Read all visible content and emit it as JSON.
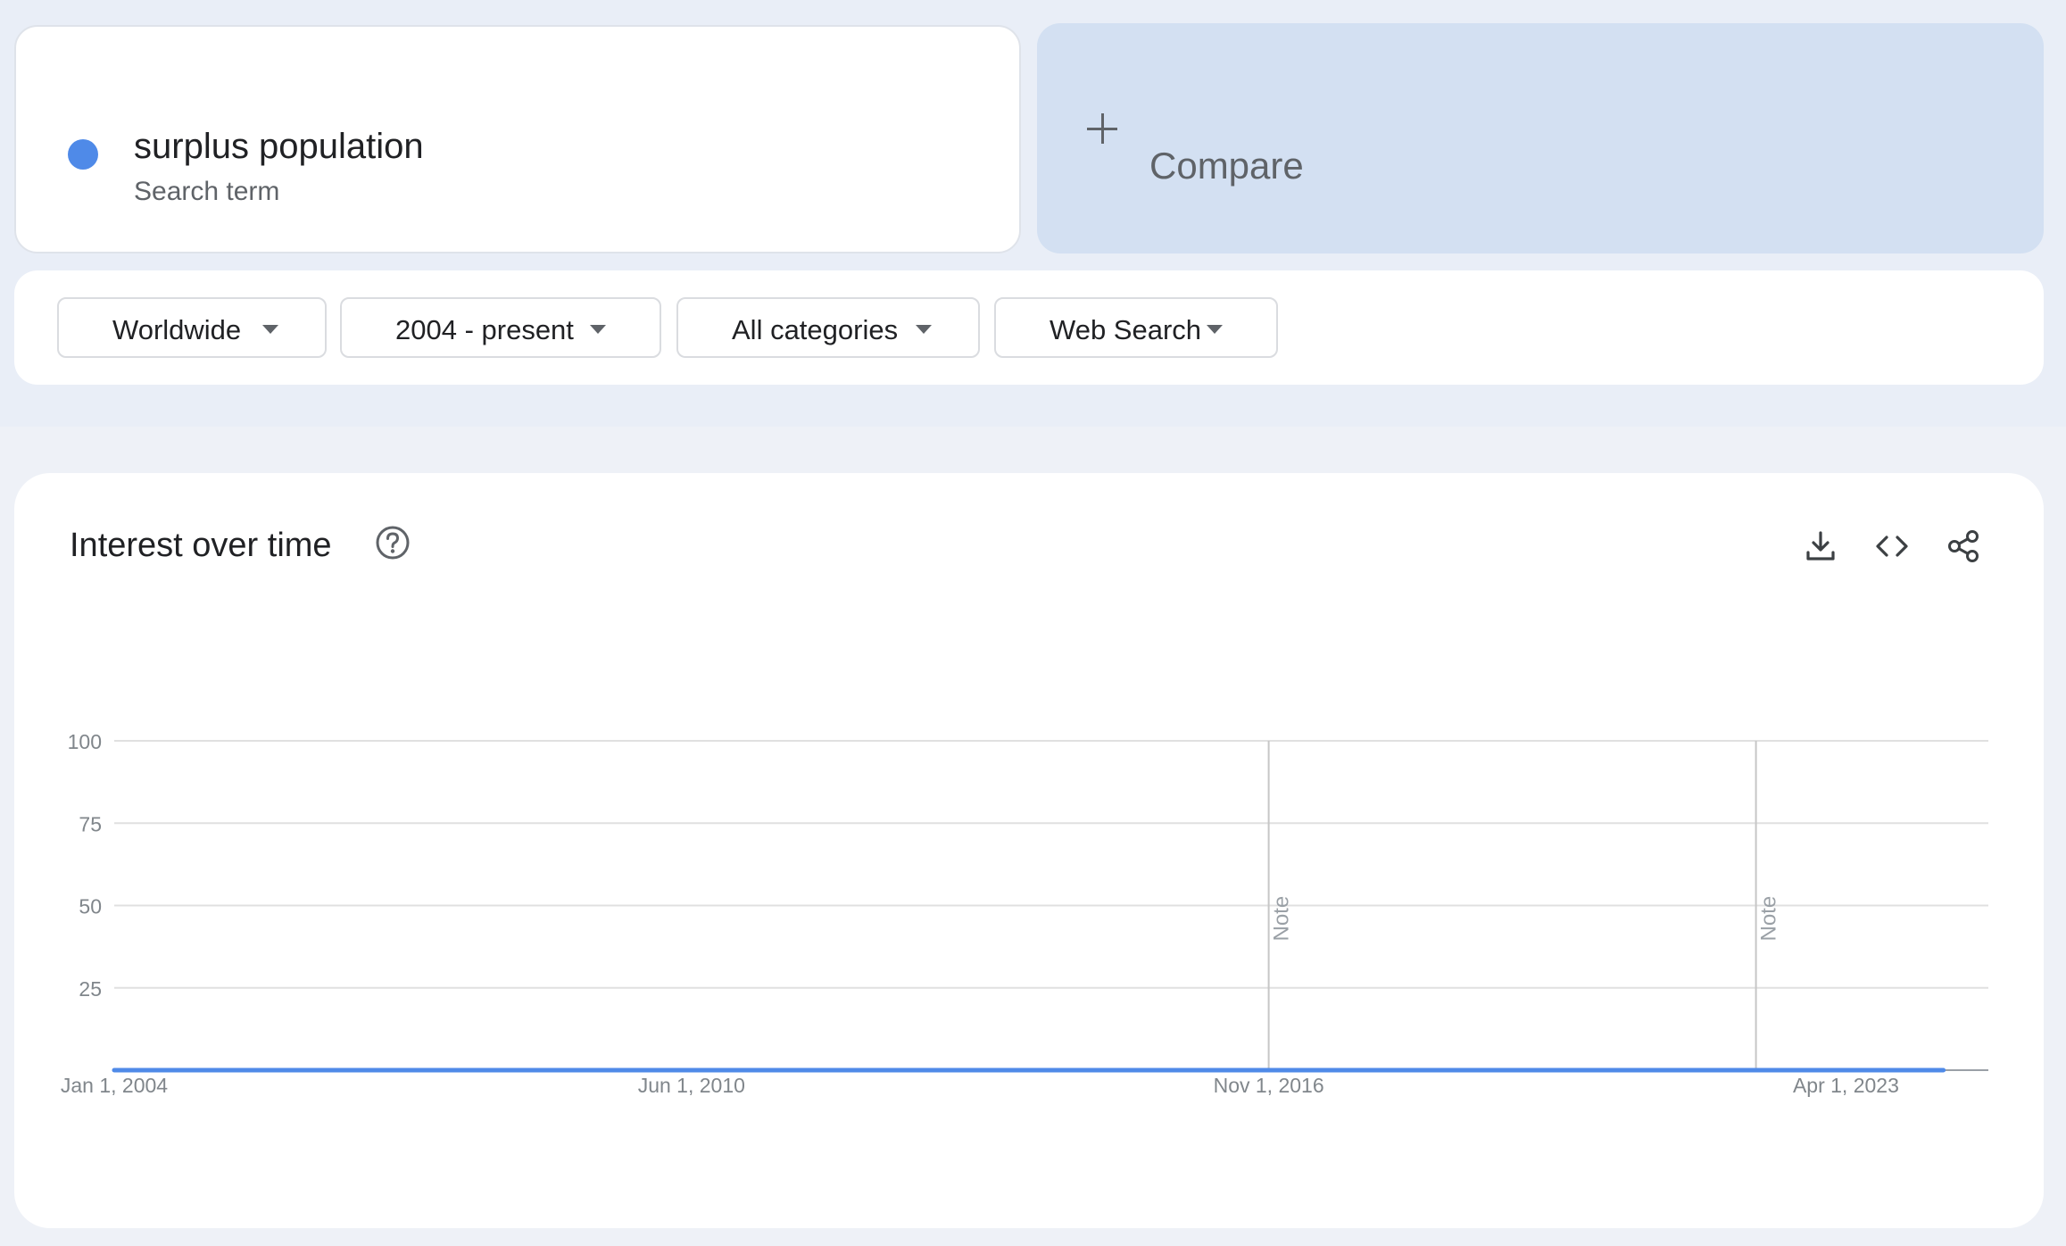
{
  "search_terms": [
    {
      "name": "surplus population",
      "kind": "Search term",
      "color": "#4f8ae8"
    }
  ],
  "compare": {
    "label": "Compare",
    "icon": "plus-icon"
  },
  "filters": [
    {
      "label": "Worldwide",
      "icon": "caret-down-icon"
    },
    {
      "label": "2004 - present",
      "icon": "caret-down-icon"
    },
    {
      "label": "All categories",
      "icon": "caret-down-icon"
    },
    {
      "label": "Web Search",
      "icon": "caret-down-icon"
    }
  ],
  "interest": {
    "title": "Interest over time",
    "help_icon": "help-circle-icon",
    "tools": [
      "download-icon",
      "embed-code-icon",
      "share-icon"
    ]
  },
  "colors": {
    "accent": "#4f8ae8",
    "grid": "#e0e0e0",
    "axis_text": "#80868b"
  },
  "chart_data": {
    "type": "line",
    "title": "",
    "xlabel": "",
    "ylabel": "",
    "ylim": [
      0,
      100
    ],
    "y_ticks": [
      25,
      50,
      75,
      100
    ],
    "x_ticks": [
      "Jan 1, 2004",
      "Jun 1, 2010",
      "Nov 1, 2016",
      "Apr 1, 2023"
    ],
    "x_range": [
      "2004-01",
      "2024-11"
    ],
    "grid": true,
    "legend": "none",
    "annotations": [
      {
        "label": "Note",
        "x": "2016-11"
      },
      {
        "label": "Note",
        "x": "2022-04"
      }
    ],
    "partial_from": "2024-10",
    "series": [
      {
        "color": "#4f8ae8",
        "x_start": "2004-01",
        "step": "month",
        "values": [
          0,
          0,
          0,
          0,
          0,
          0,
          0,
          0,
          0,
          0,
          0,
          0,
          0,
          0,
          0,
          0,
          0,
          0,
          0,
          0,
          0,
          0,
          0,
          0,
          0,
          0,
          0,
          0,
          0,
          0,
          0,
          0,
          0,
          0,
          0,
          0,
          0,
          0,
          0,
          0,
          0,
          0,
          0,
          0,
          0,
          0,
          0,
          0,
          0,
          0,
          0,
          0,
          0,
          0,
          0,
          0,
          0,
          0,
          0,
          0,
          0,
          0,
          0,
          0,
          0,
          0,
          0,
          0,
          0,
          0,
          0,
          0,
          0,
          0,
          0,
          0,
          0,
          0,
          0,
          0,
          0,
          0,
          0,
          0,
          0,
          0,
          0,
          0,
          0,
          0,
          0,
          0,
          0,
          0,
          0,
          0,
          0,
          0,
          0,
          0,
          0,
          0,
          0,
          0,
          0,
          0,
          0,
          0,
          0,
          0,
          0,
          0,
          0,
          0,
          0,
          0,
          0,
          0,
          0,
          0,
          0,
          0,
          0,
          0,
          0,
          0,
          0,
          0,
          0,
          0,
          0,
          0,
          0,
          0,
          0,
          0,
          0,
          0,
          0,
          0,
          0,
          0,
          0,
          0,
          0,
          0,
          0,
          0,
          0,
          0,
          0,
          0,
          0,
          0,
          0,
          0,
          0,
          0,
          0,
          0,
          0,
          0,
          0,
          0,
          0,
          0,
          0,
          0,
          0,
          0,
          0,
          0,
          0,
          0,
          0,
          0,
          0,
          0,
          0,
          0,
          0,
          0,
          0,
          0,
          0,
          0,
          0,
          0,
          0,
          0,
          0,
          0,
          0,
          0,
          0,
          0,
          0,
          0,
          0,
          0,
          0,
          0,
          0,
          0,
          0,
          0,
          0,
          0,
          0,
          0,
          0,
          0,
          0,
          0,
          0,
          0,
          0,
          0,
          0,
          0,
          0,
          0,
          0,
          0,
          0,
          0,
          0,
          0,
          0,
          0,
          0,
          0,
          0,
          0,
          0,
          0,
          0,
          0,
          0,
          0,
          0,
          0,
          0,
          0,
          0
        ]
      }
    ]
  }
}
